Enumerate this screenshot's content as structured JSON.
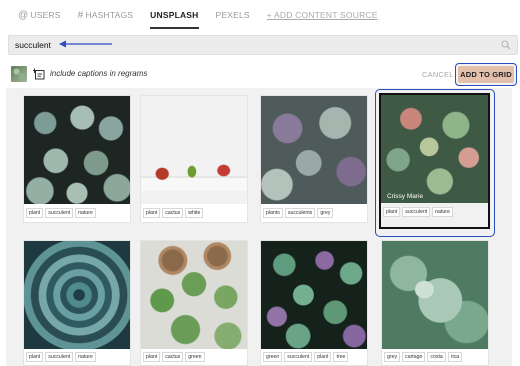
{
  "tabs": [
    {
      "label": "USERS",
      "icon": "at-icon"
    },
    {
      "label": "HASHTAGS",
      "icon": "hash-icon"
    },
    {
      "label": "UNSPLASH",
      "active": true
    },
    {
      "label": "PEXELS"
    },
    {
      "label": "+ ADD CONTENT SOURCE"
    }
  ],
  "search": {
    "value": "succulent"
  },
  "captions": {
    "label": "include captions in regrams",
    "cancel": "CANCEL",
    "add_to_grid": "ADD TO GRID"
  },
  "colors": {
    "selection_outline": "#2b4bc0",
    "add_button_bg": "#e3c0ac",
    "annotation_arrow": "#2b4bc0"
  },
  "cards": [
    {
      "tags": [
        "plant",
        "succulent",
        "nature"
      ]
    },
    {
      "tags": [
        "plant",
        "cactus",
        "white"
      ]
    },
    {
      "tags": [
        "plants",
        "succulents",
        "grey"
      ]
    },
    {
      "tags": [
        "plant",
        "succulent",
        "nature"
      ],
      "credit": "Crissy Marie",
      "selected": true
    },
    {
      "tags": [
        "plant",
        "succulent",
        "nature"
      ]
    },
    {
      "tags": [
        "plant",
        "cactus",
        "green"
      ]
    },
    {
      "tags": [
        "green",
        "succulent",
        "plant",
        "tree"
      ]
    },
    {
      "tags": [
        "grey",
        "cartago",
        "costa",
        "rica"
      ]
    }
  ]
}
